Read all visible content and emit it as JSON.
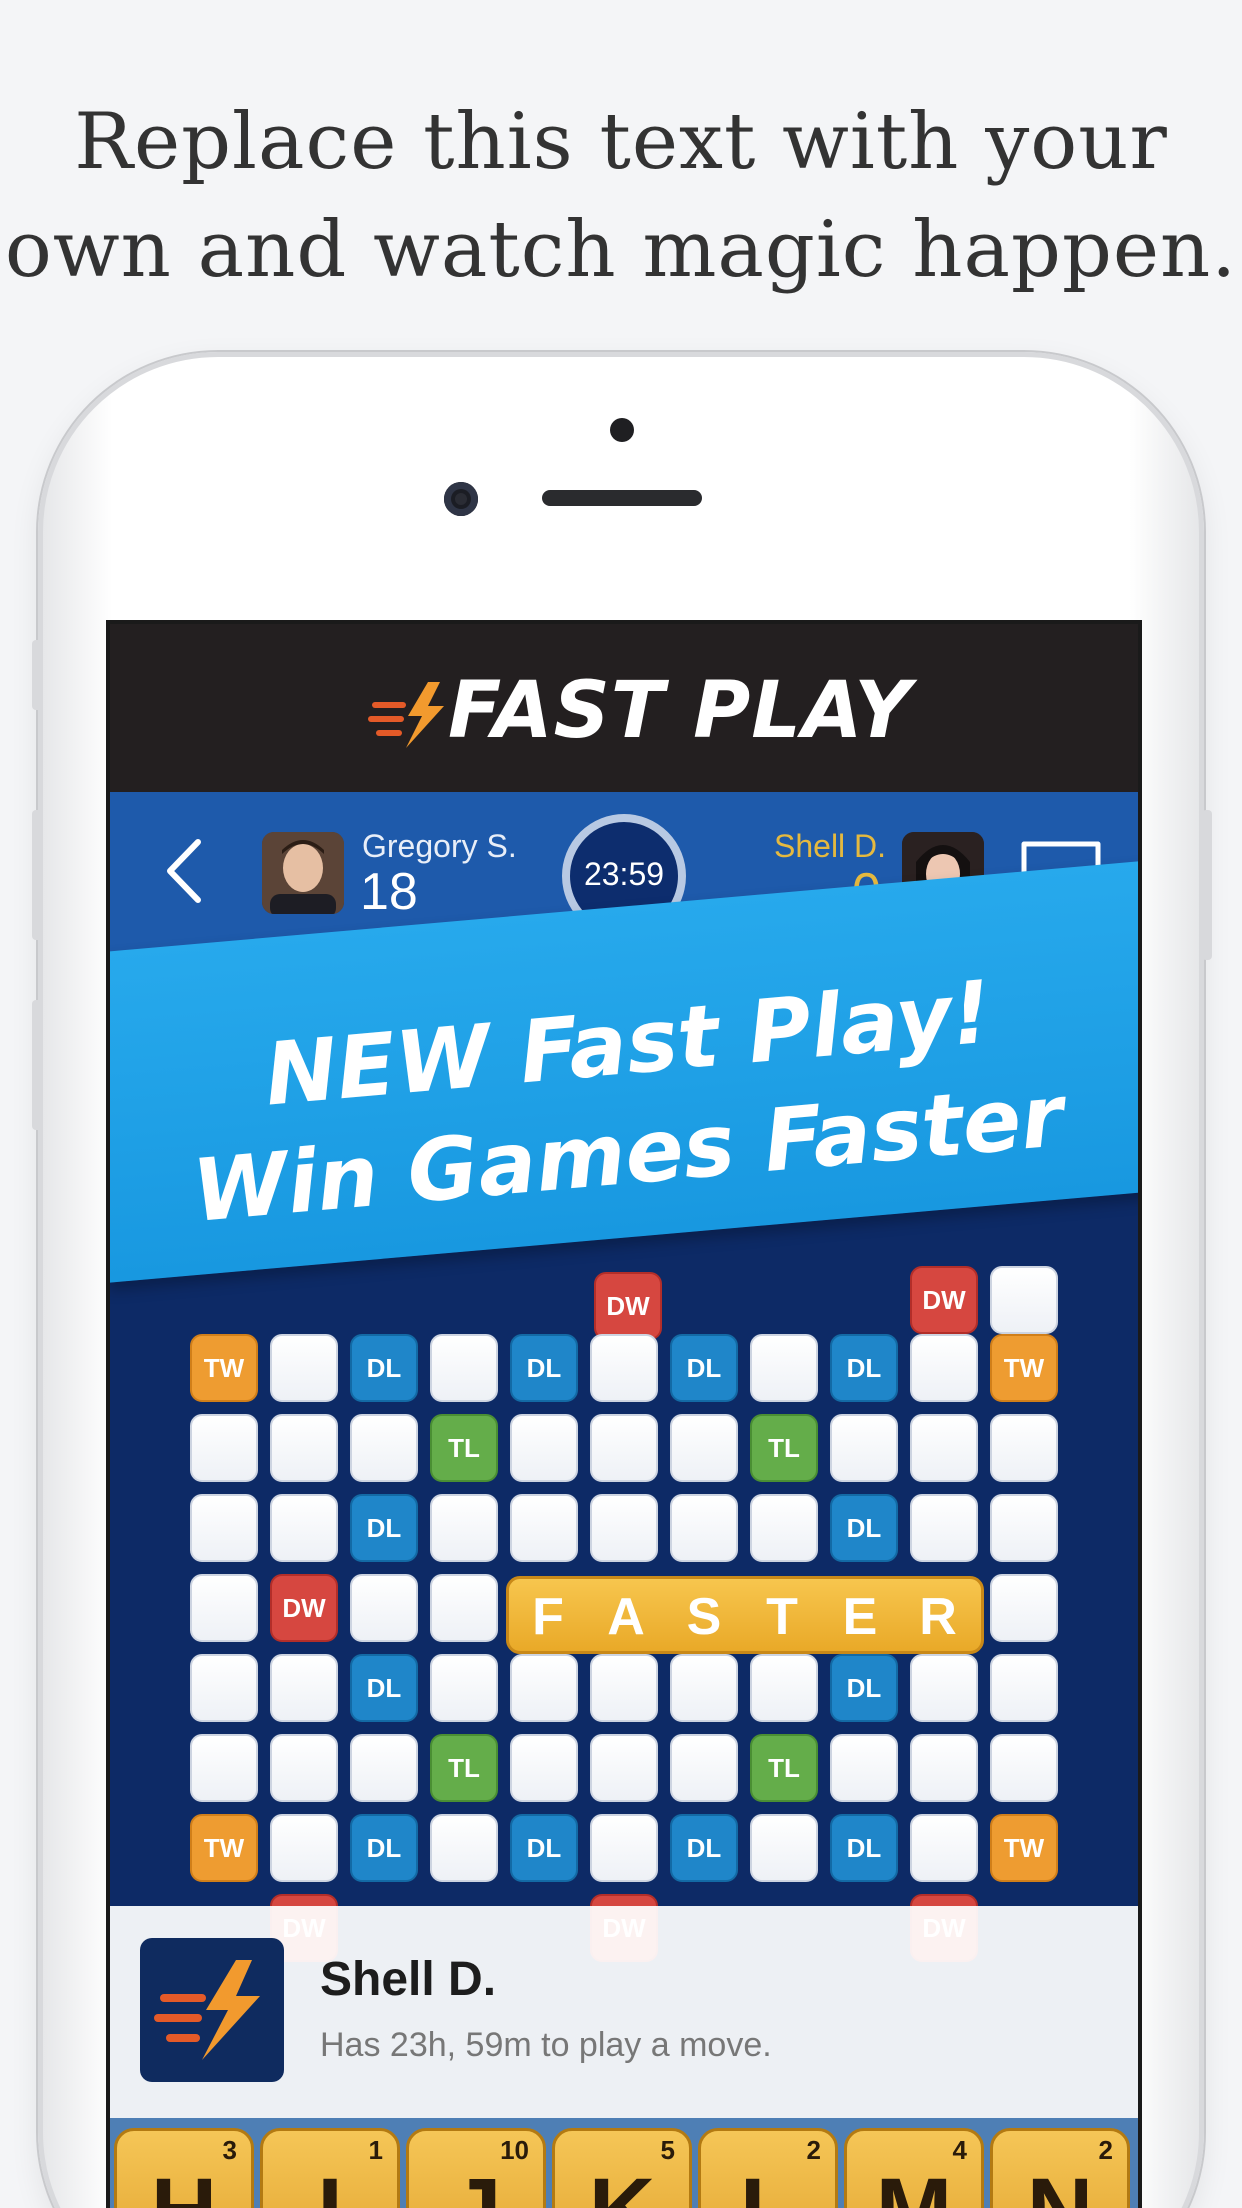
{
  "headline": {
    "line1": "Replace this text with your",
    "line2": "own and watch magic happen."
  },
  "app": {
    "banner_title": "FAST PLAY",
    "colors": {
      "banner_bg": "#231f20",
      "header_bg": "#1e5aab",
      "bolt_orange": "#f29a2e"
    }
  },
  "game": {
    "player_left": {
      "name": "Gregory S.",
      "score": "18"
    },
    "player_right": {
      "name": "Shell D.",
      "score": "0"
    },
    "timer": "23:59"
  },
  "promo": {
    "line1": "NEW Fast Play!",
    "line2": "Win Games Faster"
  },
  "board": {
    "premium_labels": {
      "tw": "TW",
      "dw": "DW",
      "dl": "DL",
      "tl": "TL"
    },
    "word": [
      "F",
      "A",
      "S",
      "T",
      "E",
      "R"
    ]
  },
  "notification": {
    "title": "Shell D.",
    "body": "Has 23h, 59m to play a move."
  },
  "rack": [
    {
      "letter": "H",
      "points": "3"
    },
    {
      "letter": "I",
      "points": "1"
    },
    {
      "letter": "J",
      "points": "10"
    },
    {
      "letter": "K",
      "points": "5"
    },
    {
      "letter": "L",
      "points": "2"
    },
    {
      "letter": "M",
      "points": "4"
    },
    {
      "letter": "N",
      "points": "2"
    }
  ]
}
